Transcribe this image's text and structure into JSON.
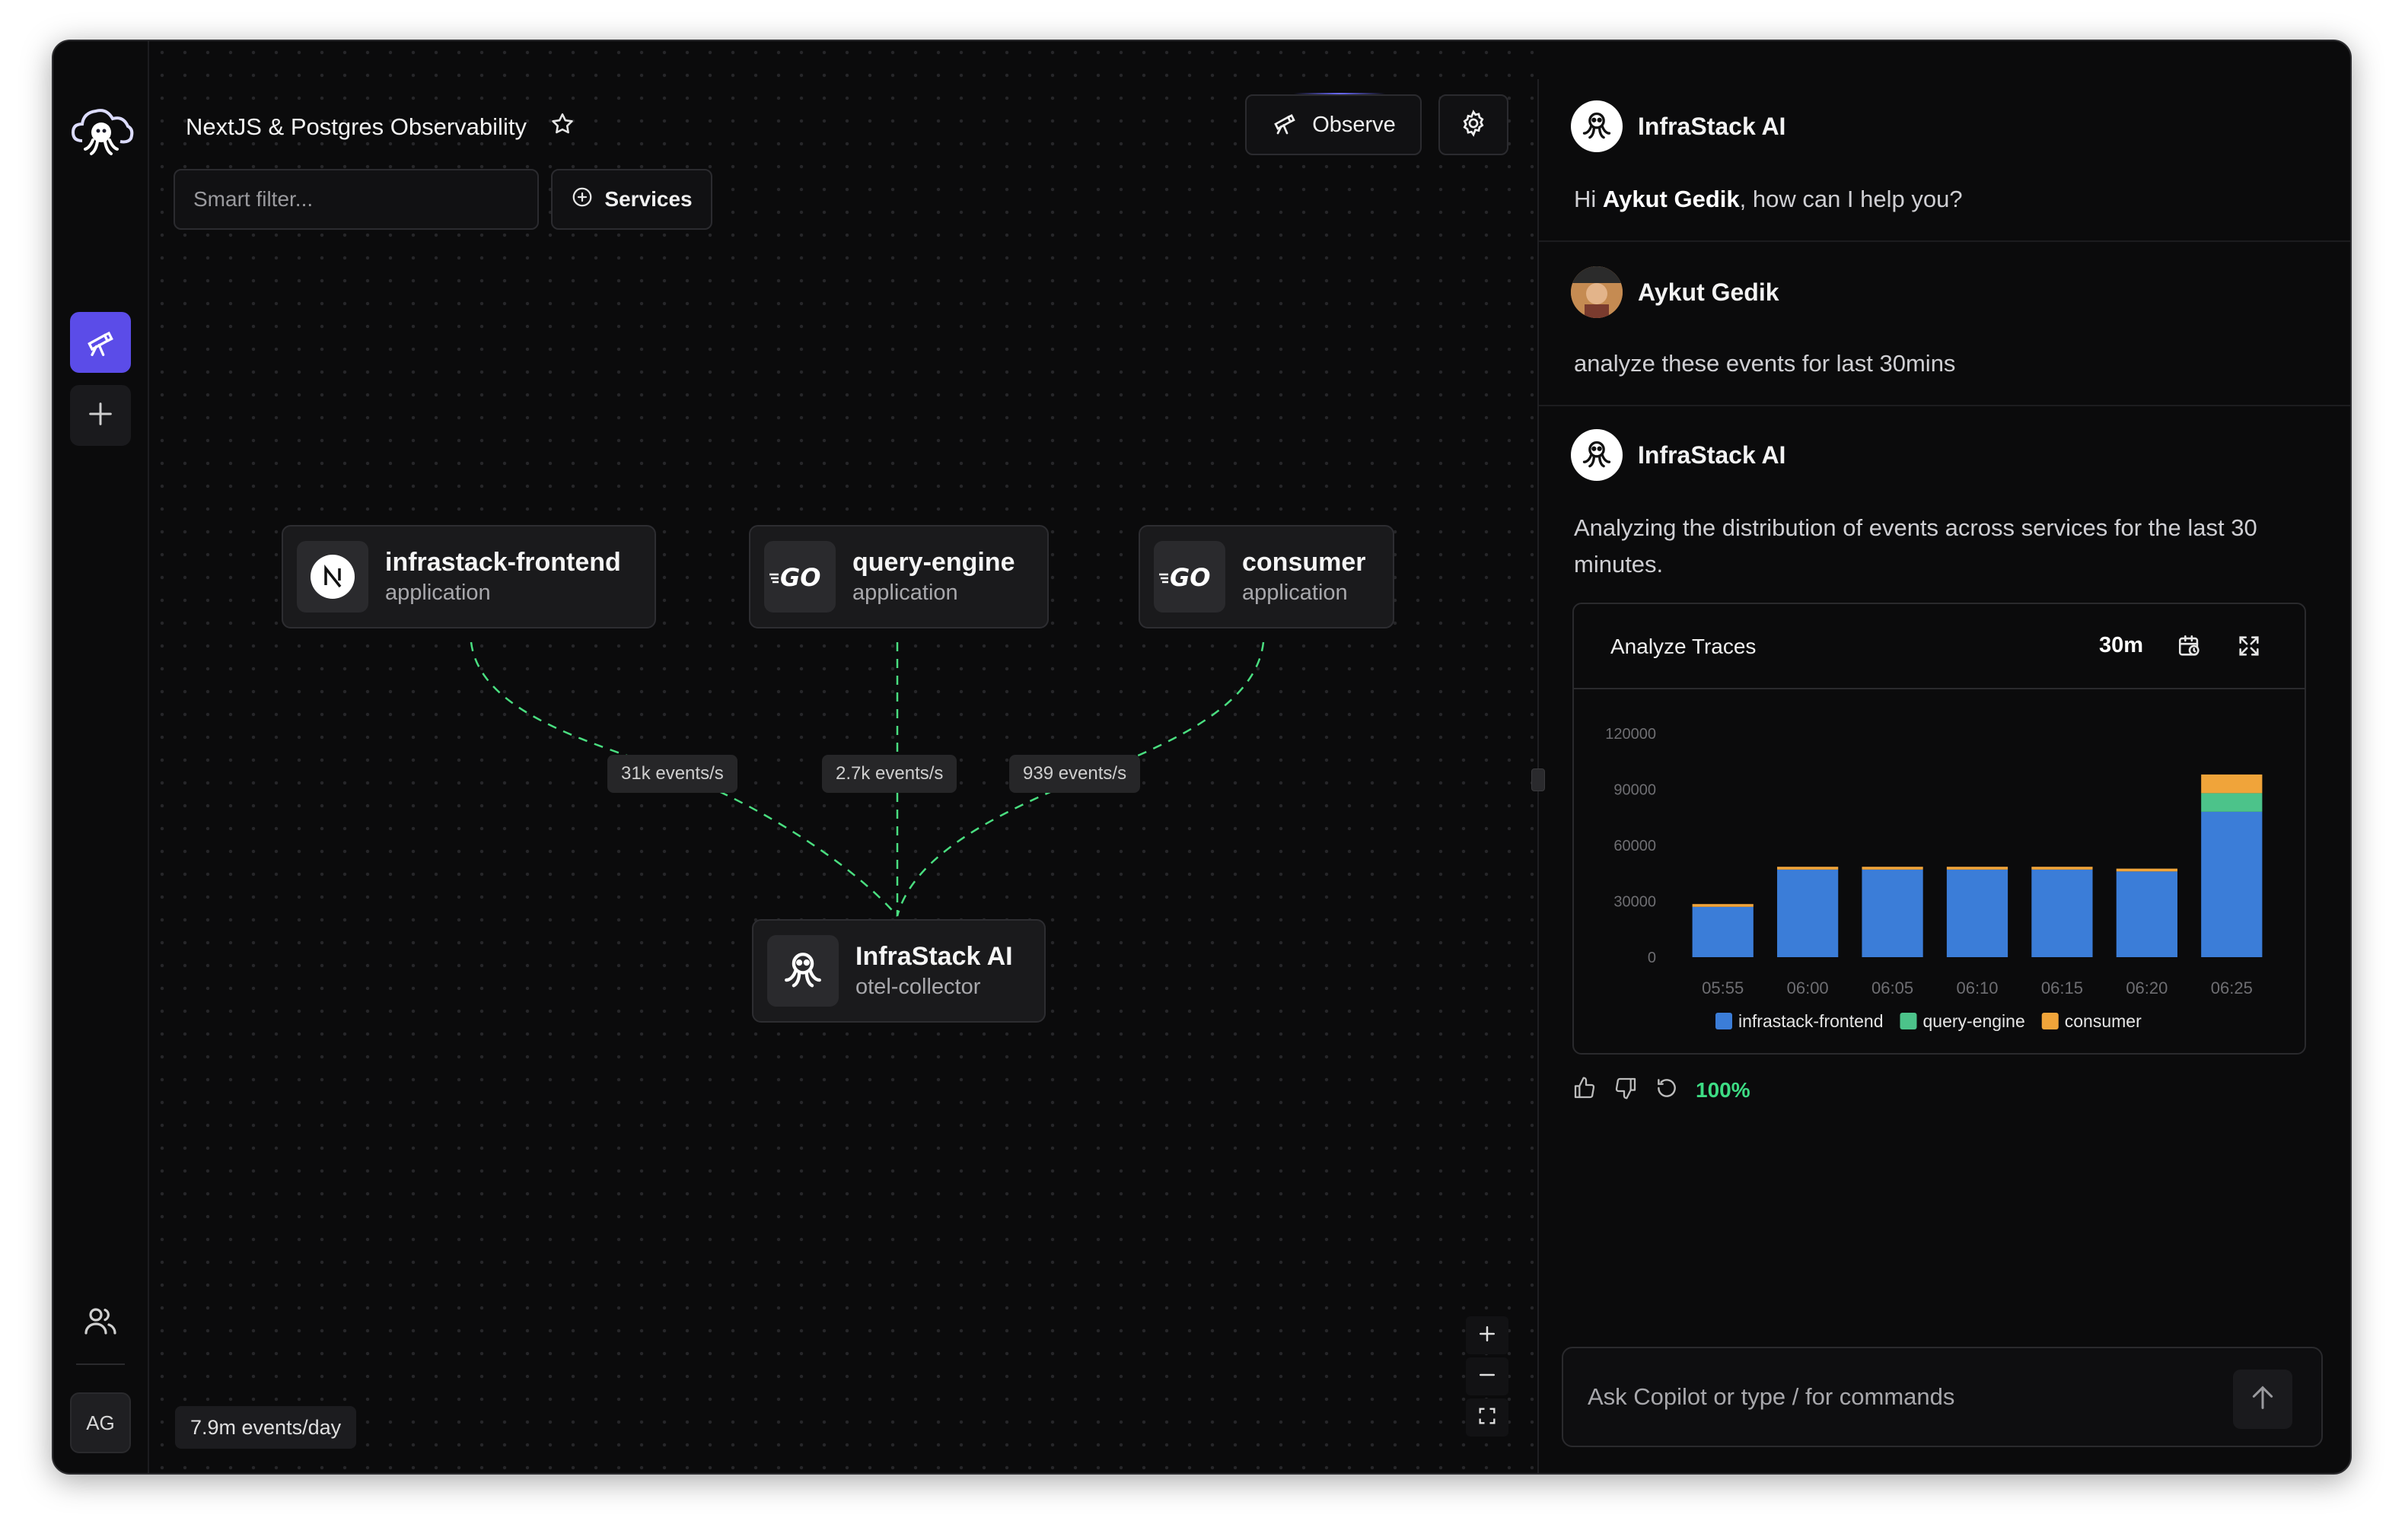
{
  "workspace": {
    "title": "NextJS & Postgres Observability"
  },
  "toolbar": {
    "filter_placeholder": "Smart filter...",
    "services_label": "Services",
    "observe_label": "Observe"
  },
  "rail": {
    "user_initials": "AG"
  },
  "graph": {
    "nodes": [
      {
        "name": "infrastack-frontend",
        "type": "application",
        "icon": "nextjs-icon"
      },
      {
        "name": "query-engine",
        "type": "application",
        "icon": "go-icon"
      },
      {
        "name": "consumer",
        "type": "application",
        "icon": "go-icon"
      },
      {
        "name": "InfraStack AI",
        "type": "otel-collector",
        "icon": "octopus-icon"
      }
    ],
    "edges": [
      {
        "from": "infrastack-frontend",
        "label": "31k events/s"
      },
      {
        "from": "query-engine",
        "label": "2.7k events/s"
      },
      {
        "from": "consumer",
        "label": "939 events/s"
      }
    ],
    "events_per_day": "7.9m events/day",
    "edge_color": "#4ade80"
  },
  "chat": {
    "assistant_name": "InfraStack AI",
    "user_name": "Aykut Gedik",
    "greeting_prefix": "Hi ",
    "greeting_name": "Aykut Gedik",
    "greeting_suffix": ", how can I help you?",
    "user_message": "analyze these events for last 30mins",
    "assistant_message": "Analyzing the distribution of events across services for the last 30 minutes.",
    "chart_card": {
      "title": "Analyze Traces",
      "range": "30m"
    },
    "confidence": "100%",
    "input_placeholder": "Ask Copilot or type / for commands"
  },
  "chart_data": {
    "type": "bar",
    "stacked": true,
    "categories": [
      "05:55",
      "06:00",
      "06:05",
      "06:10",
      "06:15",
      "06:20",
      "06:25"
    ],
    "series": [
      {
        "name": "infrastack-frontend",
        "color": "#3b7dd8",
        "values": [
          27000,
          47000,
          47000,
          47000,
          47000,
          46000,
          78000
        ]
      },
      {
        "name": "query-engine",
        "color": "#4cc38a",
        "values": [
          0,
          0,
          0,
          0,
          0,
          0,
          10000
        ]
      },
      {
        "name": "consumer",
        "color": "#f0a43a",
        "values": [
          1500,
          1500,
          1500,
          1500,
          1500,
          1500,
          10000
        ]
      }
    ],
    "yticks": [
      0,
      30000,
      60000,
      90000,
      120000
    ],
    "ylim": [
      0,
      120000
    ],
    "legend": "bottom"
  }
}
